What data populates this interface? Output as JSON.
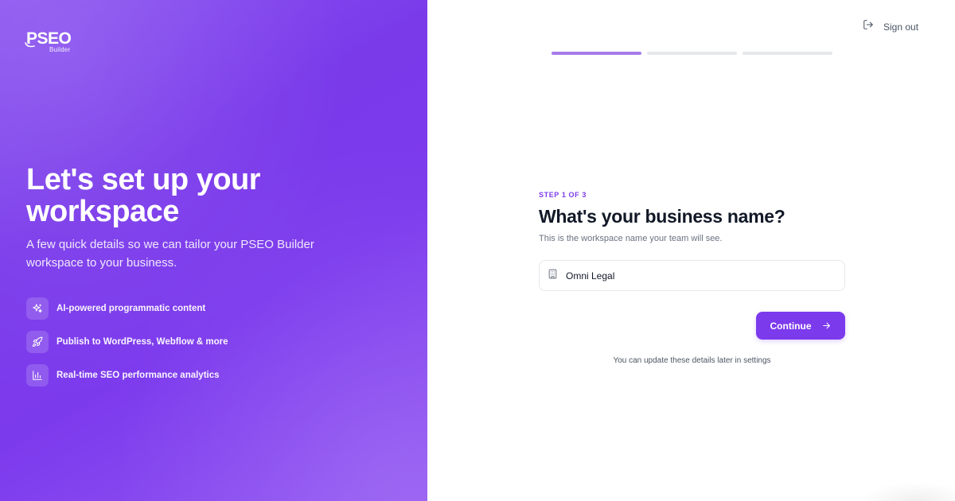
{
  "brand": {
    "logo_main": "PSEO",
    "logo_sub": "Builder"
  },
  "hero": {
    "title": "Let's set up your workspace",
    "subtitle": "A few quick details so we can tailor your PSEO Builder workspace to your business."
  },
  "features": [
    {
      "icon": "sparkles-icon",
      "label": "AI-powered programmatic content"
    },
    {
      "icon": "rocket-icon",
      "label": "Publish to WordPress, Webflow & more"
    },
    {
      "icon": "bar-chart-icon",
      "label": "Real-time SEO performance analytics"
    }
  ],
  "header": {
    "signout_label": "Sign out",
    "signout_icon": "sign-out-icon"
  },
  "progress": {
    "total_steps": 3,
    "current_step": 1
  },
  "form": {
    "step_label": "STEP 1 OF 3",
    "title": "What's your business name?",
    "subtitle": "This is the workspace name your team will see.",
    "input_icon": "building-icon",
    "input_value": "Omni Legal",
    "continue_label": "Continue",
    "footnote": "You can update these details later in settings"
  },
  "colors": {
    "accent": "#7c3aed",
    "progress_active": "#a67ce8",
    "progress_inactive": "#e5e7eb"
  }
}
